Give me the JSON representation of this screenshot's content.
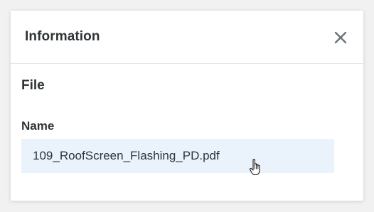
{
  "dialog": {
    "title": "Information",
    "close_icon": "close-icon",
    "section_title": "File",
    "fields": [
      {
        "label": "Name",
        "value": "109_RoofScreen_Flashing_PD.pdf"
      }
    ]
  },
  "cursor": {
    "icon": "hand-pointer-icon"
  },
  "colors": {
    "background": "#f1f1f1",
    "dialog_bg": "#ffffff",
    "field_bg": "#eaf2fc",
    "text": "#303437",
    "close_icon": "#6b7378"
  }
}
